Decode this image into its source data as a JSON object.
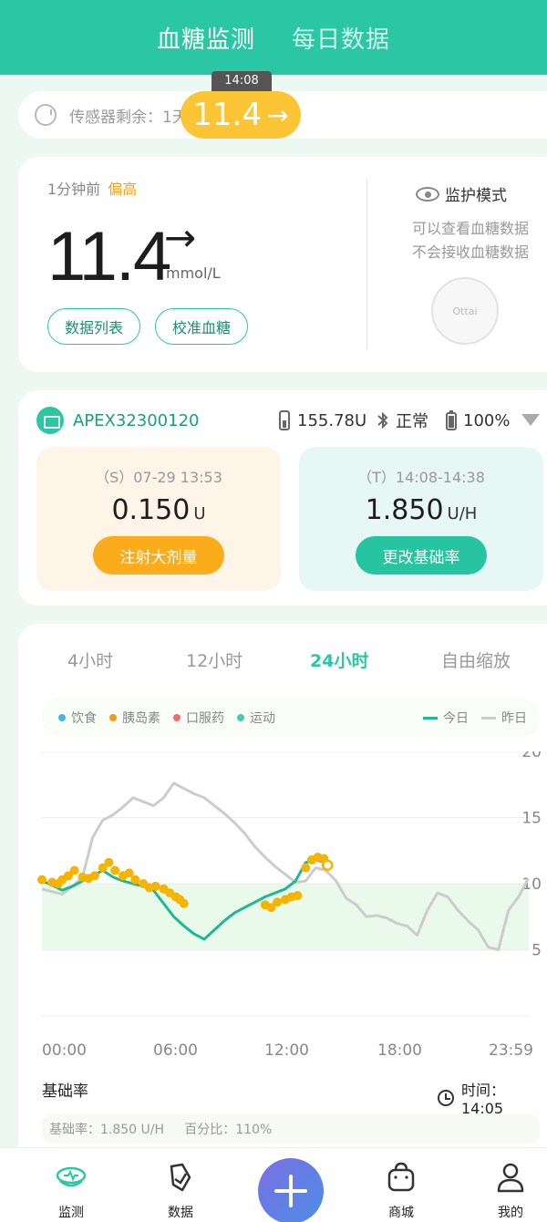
{
  "header": {
    "tabs": [
      {
        "label": "血糖监测"
      },
      {
        "label": "每日数据"
      }
    ]
  },
  "sensor": {
    "label": "传感器剩余：1天",
    "bubble_time": "14:08",
    "bubble_value": "11.4",
    "bubble_arrow": "→"
  },
  "current": {
    "ago": "1分钟前",
    "status": "偏高",
    "value": "11.4",
    "arrow": "→",
    "unit": "mmol/L",
    "btn_list": "数据列表",
    "btn_calibrate": "校准血糖"
  },
  "monitor": {
    "title": "监护模式",
    "desc1": "可以查看血糖数据",
    "desc2": "不会接收血糖数据",
    "device_text": "Ottai"
  },
  "pump": {
    "id": "APEX32300120",
    "insulin": "155.78U",
    "connection": "正常",
    "battery": "100%",
    "bolus": {
      "time": "（S）07-29 13:53",
      "value": "0.150",
      "unit": "U",
      "button": "注射大剂量"
    },
    "basal": {
      "time": "（T）14:08-14:38",
      "value": "1.850",
      "unit": "U/H",
      "button": "更改基础率"
    }
  },
  "chart": {
    "ranges": [
      "4小时",
      "12小时",
      "24小时",
      "自由缩放"
    ],
    "active_range": 2,
    "legend": [
      {
        "label": "饮食",
        "color": "#3fb6e8"
      },
      {
        "label": "胰岛素",
        "color": "#f39c12"
      },
      {
        "label": "口服药",
        "color": "#f26b6b"
      },
      {
        "label": "运动",
        "color": "#3ccfae"
      }
    ],
    "legend_right": [
      {
        "label": "今日",
        "color": "#1fb894"
      },
      {
        "label": "昨日",
        "color": "#cccccc"
      }
    ],
    "x_ticks": [
      "00:00",
      "06:00",
      "12:00",
      "18:00",
      "23:59"
    ],
    "basal_title": "基础率",
    "time_label": "时间：14:05",
    "basal_strip": "基础率：1.850 U/H     百分比：110%"
  },
  "chart_data": {
    "type": "line",
    "ylim": [
      0,
      20
    ],
    "yticks": [
      5,
      10,
      15,
      20
    ],
    "target_range": [
      5,
      10
    ],
    "colors": {
      "today": "#1fb894",
      "yesterday": "#cccccc",
      "insulin": "#f4b400",
      "band": "#e9f9ea"
    },
    "series": [
      {
        "name": "今日",
        "x": [
          0,
          0.5,
          1,
          1.5,
          2,
          2.5,
          3,
          3.5,
          4,
          4.5,
          5,
          5.5,
          6,
          6.5,
          7,
          7.5,
          8,
          8.5,
          9,
          9.5,
          10,
          10.5,
          11,
          11.5,
          12,
          12.5,
          13,
          13.5,
          14,
          14.08
        ],
        "y": [
          10.2,
          9.9,
          9.5,
          9.8,
          10.2,
          10.6,
          11.0,
          10.5,
          10.2,
          10.0,
          9.8,
          9.5,
          8.5,
          7.5,
          6.8,
          6.2,
          5.8,
          6.5,
          7.2,
          7.8,
          8.2,
          8.6,
          9.0,
          9.3,
          9.6,
          10.2,
          11.6,
          11.8,
          11.6,
          11.4
        ]
      },
      {
        "name": "昨日",
        "x": [
          0,
          1,
          1.5,
          2,
          2.5,
          3,
          3.5,
          4,
          4.5,
          5,
          5.5,
          6,
          6.5,
          7,
          7.5,
          8,
          8.5,
          9,
          9.5,
          10,
          10.5,
          11,
          11.5,
          12,
          12.5,
          13,
          13.5,
          14,
          14.5,
          15,
          15.5,
          16,
          16.5,
          17,
          17.5,
          18,
          18.5,
          19,
          19.5,
          20,
          20.5,
          21,
          21.5,
          22,
          22.5,
          23,
          23.5,
          23.98
        ],
        "y": [
          9.6,
          9.2,
          9.8,
          10.5,
          13.5,
          14.8,
          15.2,
          15.8,
          16.5,
          16.2,
          15.9,
          16.5,
          17.6,
          17.2,
          16.8,
          16.5,
          15.9,
          15.3,
          14.6,
          13.8,
          12.8,
          12.0,
          11.3,
          10.7,
          10.1,
          10.2,
          11.2,
          11.0,
          10.2,
          8.9,
          8.4,
          7.5,
          7.6,
          7.4,
          7.0,
          6.8,
          6.1,
          8.0,
          9.3,
          9.0,
          8.0,
          7.2,
          6.5,
          5.2,
          5.0,
          8.0,
          9.0,
          10.4
        ]
      },
      {
        "name": "胰岛素",
        "x": [
          0,
          0.5,
          0.8,
          1.0,
          1.3,
          1.6,
          2.0,
          2.3,
          2.6,
          3.0,
          3.3,
          3.6,
          4.0,
          4.3,
          4.6,
          5.0,
          5.3,
          5.6,
          6.0,
          6.3,
          6.6,
          6.8,
          7.0,
          11.0,
          11.3,
          11.6,
          12.0,
          12.3,
          12.6,
          13.0,
          13.3,
          13.6,
          13.9,
          14.0
        ],
        "y": [
          10.3,
          10.1,
          10.0,
          10.3,
          10.6,
          11.0,
          10.5,
          10.4,
          10.6,
          11.2,
          11.6,
          11.0,
          10.6,
          10.8,
          10.3,
          10.0,
          9.7,
          9.8,
          9.6,
          9.3,
          9.0,
          8.8,
          8.5,
          8.4,
          8.2,
          8.6,
          8.8,
          9.0,
          9.1,
          11.2,
          11.8,
          12.0,
          11.9,
          11.4
        ]
      }
    ]
  },
  "nav": {
    "items": [
      {
        "label": "监测"
      },
      {
        "label": "数据"
      },
      {
        "label": ""
      },
      {
        "label": "商城"
      },
      {
        "label": "我的"
      }
    ]
  }
}
